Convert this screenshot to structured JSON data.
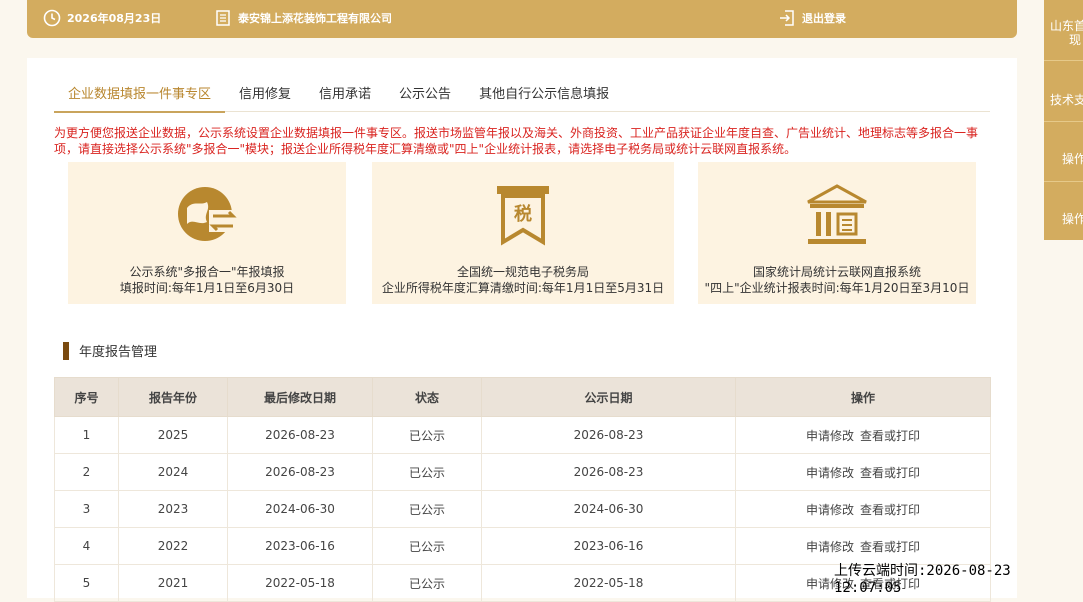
{
  "header": {
    "date": "2026年08月23日",
    "company": "泰安锦上添花装饰工程有限公司",
    "logout": "退出登录"
  },
  "tabs": [
    "企业数据填报一件事专区",
    "信用修复",
    "信用承诺",
    "公示公告",
    "其他自行公示信息填报"
  ],
  "notice": "为更方便您报送企业数据，公示系统设置企业数据填报一件事专区。报送市场监管年报以及海关、外商投资、工业产品获证企业年度自查、广告业统计、地理标志等多报合一事项，请直接选择公示系统\"多报合一\"模块；报送企业所得税年度汇算清缴或\"四上\"企业统计报表，请选择电子税务局或统计云联网直报系统。",
  "cards": [
    {
      "line1": "公示系统\"多报合一\"年报填报",
      "line2": "填报时间:每年1月1日至6月30日",
      "icon": "globe-exchange-icon"
    },
    {
      "line1": "全国统一规范电子税务局",
      "line2": "企业所得税年度汇算清缴时间:每年1月1日至5月31日",
      "icon": "tax-icon",
      "icon_text": "税"
    },
    {
      "line1": "国家统计局统计云联网直报系统",
      "line2": "\"四上\"企业统计报表时间:每年1月20日至3月10日",
      "icon": "bank-building-icon"
    }
  ],
  "section": {
    "title": "年度报告管理"
  },
  "table": {
    "headers": [
      "序号",
      "报告年份",
      "最后修改日期",
      "状态",
      "公示日期",
      "操作"
    ],
    "rows": [
      {
        "no": "1",
        "year": "2025",
        "modified": "2026-08-23",
        "status": "已公示",
        "published": "2026-08-23"
      },
      {
        "no": "2",
        "year": "2024",
        "modified": "2026-08-23",
        "status": "已公示",
        "published": "2026-08-23"
      },
      {
        "no": "3",
        "year": "2023",
        "modified": "2024-06-30",
        "status": "已公示",
        "published": "2024-06-30"
      },
      {
        "no": "4",
        "year": "2022",
        "modified": "2023-06-16",
        "status": "已公示",
        "published": "2023-06-16"
      },
      {
        "no": "5",
        "year": "2021",
        "modified": "2022-05-18",
        "status": "已公示",
        "published": "2022-05-18"
      }
    ],
    "op_modify": "申请修改",
    "op_print": "查看或打印"
  },
  "sidebar": {
    "item1_line1": "山东首",
    "item1_line2": "现",
    "item2_line2": "技术支",
    "item3": "操作",
    "item4": "操作"
  },
  "watermark": "上传云端时间:2026-08-23 12:07:05"
}
